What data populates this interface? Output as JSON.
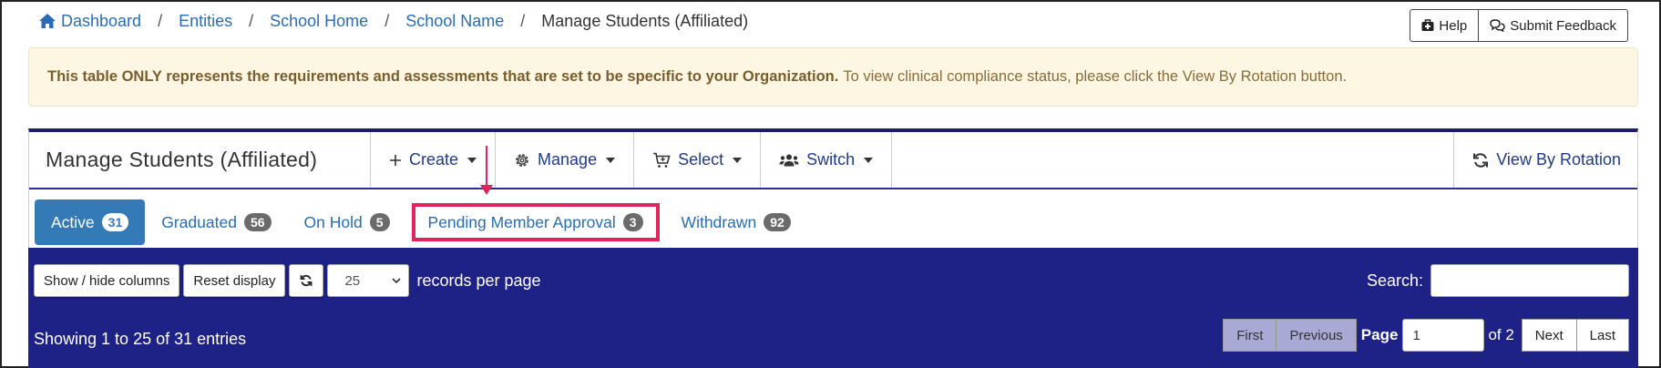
{
  "breadcrumb": {
    "items": [
      "Dashboard",
      "Entities",
      "School Home",
      "School Name"
    ],
    "current": "Manage Students (Affiliated)",
    "separator": "/"
  },
  "top_buttons": {
    "help": "Help",
    "feedback": "Submit Feedback"
  },
  "notice": {
    "bold": "This table ONLY represents the requirements and assessments that are set to be specific to your Organization.",
    "text": "To view clinical compliance status, please click the View By Rotation button."
  },
  "panel": {
    "title": "Manage Students (Affiliated)",
    "menus": {
      "create": "Create",
      "manage": "Manage",
      "select": "Select",
      "switch": "Switch"
    },
    "view_by_rotation": "View By Rotation"
  },
  "tabs": [
    {
      "label": "Active",
      "count": "31"
    },
    {
      "label": "Graduated",
      "count": "56"
    },
    {
      "label": "On Hold",
      "count": "5"
    },
    {
      "label": "Pending Member Approval",
      "count": "3"
    },
    {
      "label": "Withdrawn",
      "count": "92"
    }
  ],
  "table_tools": {
    "show_hide": "Show / hide columns",
    "reset": "Reset display",
    "page_size": "25",
    "records_per_page": "records per page",
    "search_label": "Search:"
  },
  "footer": {
    "showing": "Showing 1 to 25 of 31 entries",
    "first": "First",
    "previous": "Previous",
    "page_label": "Page",
    "page_value": "1",
    "of": "of 2",
    "next": "Next",
    "last": "Last"
  },
  "colors": {
    "accent": "#337ab7",
    "navy": "#1e2186",
    "highlight": "#e0245e"
  }
}
